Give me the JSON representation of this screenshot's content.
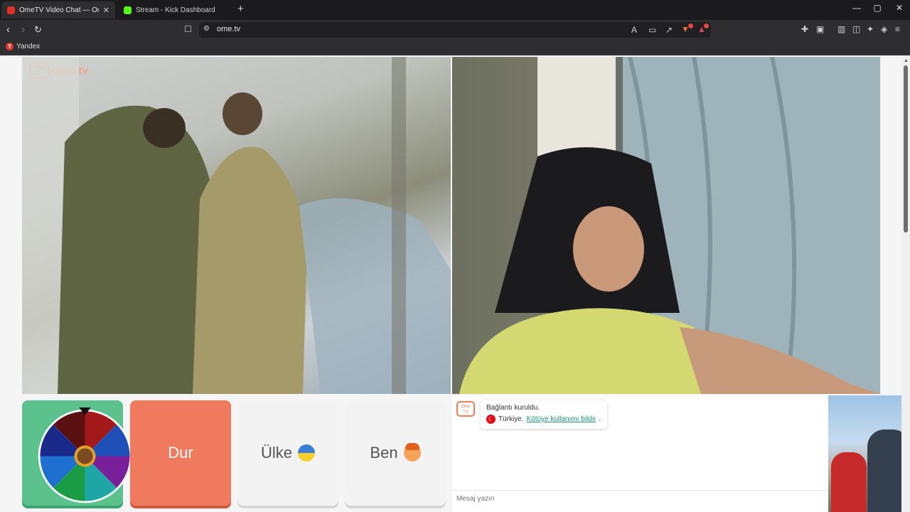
{
  "browser": {
    "tabs": [
      {
        "title": "OmeTV Video Chat — Omeg",
        "favicon_color": "#e0312b",
        "active": true
      },
      {
        "title": "Stream - Kick Dashboard",
        "favicon_color": "#53fc18",
        "active": false
      }
    ],
    "new_tab_glyph": "+",
    "window_controls": {
      "minimize": "—",
      "maximize": "▢",
      "close": "✕"
    },
    "url": "ome.tv",
    "bookmarks": [
      {
        "label": "Yandex"
      }
    ],
    "extension_badges": {
      "brave": "2",
      "alert": "1"
    }
  },
  "page": {
    "logo_text": "Ome.tv",
    "logo_small": "Ome TV",
    "controls": {
      "stop_label": "Dur",
      "country_label": "Ülke",
      "me_label": "Ben"
    },
    "chat": {
      "status": "Bağlantı kuruldu.",
      "country": "Türkiye.",
      "report_link": "Kötüye kullanımı bildir",
      "report_suffix": ".",
      "input_placeholder": "Mesaj yazın"
    }
  },
  "colors": {
    "stop_button": "#ef7a5d",
    "wheel_button": "#5bc18d",
    "link": "#1f8f73"
  }
}
